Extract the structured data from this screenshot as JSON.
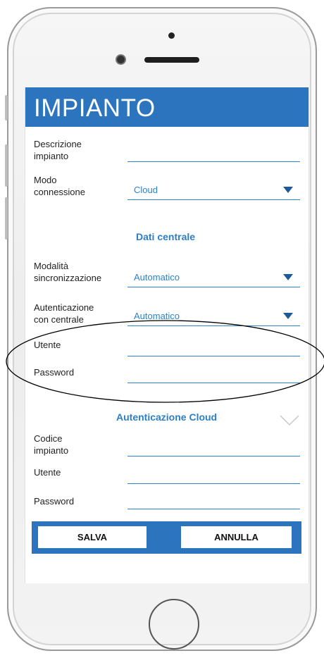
{
  "screen": {
    "title": "IMPIANTO"
  },
  "fields": {
    "descrizione": {
      "label": "Descrizione\nimpianto",
      "value": ""
    },
    "modo": {
      "label": "Modo\nconnessione",
      "value": "Cloud"
    },
    "sezione_centrale": "Dati centrale",
    "sincronizzazione": {
      "label": "Modalità\nsincronizzazione",
      "value": "Automatico"
    },
    "autenticazione": {
      "label": "Autenticazione\ncon centrale",
      "value": "Automatico"
    },
    "utente1": {
      "label": "Utente",
      "value": ""
    },
    "password1": {
      "label": "Password",
      "value": ""
    },
    "sezione_cloud": "Autenticazione Cloud",
    "codice": {
      "label": "Codice\nimpianto",
      "value": ""
    },
    "utente2": {
      "label": "Utente",
      "value": ""
    },
    "password2": {
      "label": "Password",
      "value": ""
    }
  },
  "buttons": {
    "save": "SALVA",
    "cancel": "ANNULLA"
  },
  "icons": {
    "dropdown": "triangle-down-icon",
    "collapse": "chevron-down-icon"
  },
  "colors": {
    "header": "#2c74bd",
    "accent": "#2c82c9"
  }
}
